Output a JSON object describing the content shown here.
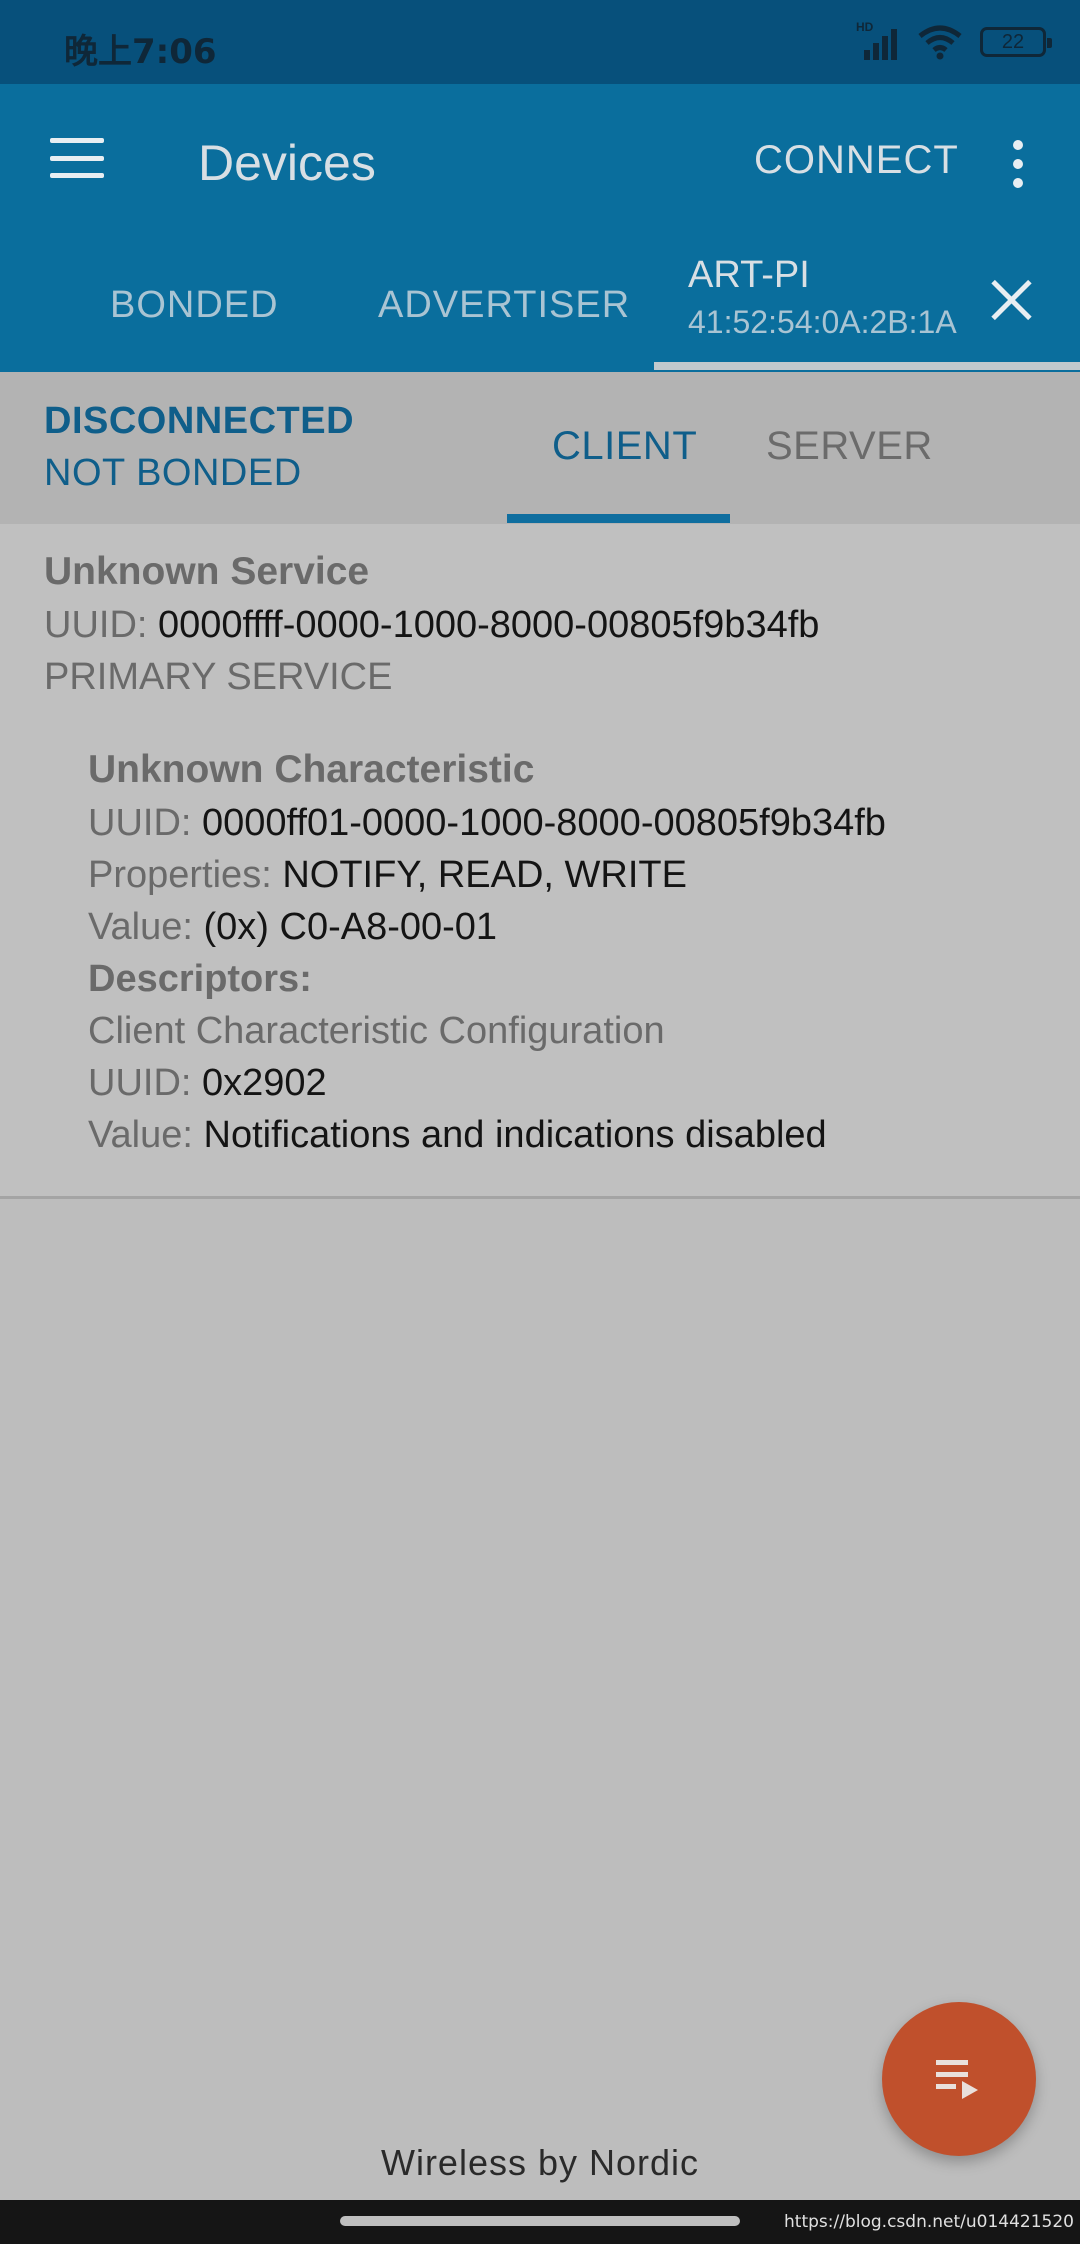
{
  "status_bar": {
    "time": "晚上7:06",
    "signal_label": "HD",
    "battery": "22"
  },
  "app_bar": {
    "title": "Devices",
    "connect_label": "CONNECT",
    "tabs": {
      "bonded": "BONDED",
      "advertiser": "ADVERTISER",
      "device_name": "ART-PI",
      "device_address": "41:52:54:0A:2B:1A"
    }
  },
  "connection": {
    "state": "DISCONNECTED",
    "bond": "NOT BONDED",
    "tabs": {
      "client": "CLIENT",
      "server": "SERVER"
    }
  },
  "service": {
    "name": "Unknown Service",
    "uuid_label": "UUID:",
    "uuid": "0000ffff-0000-1000-8000-00805f9b34fb",
    "type": "PRIMARY SERVICE",
    "characteristic": {
      "name": "Unknown Characteristic",
      "uuid_label": "UUID:",
      "uuid": "0000ff01-0000-1000-8000-00805f9b34fb",
      "properties_label": "Properties:",
      "properties": "NOTIFY, READ, WRITE",
      "value_label": "Value:",
      "value": "(0x) C0-A8-00-01",
      "descriptors_label": "Descriptors:",
      "descriptor": {
        "name": "Client Characteristic Configuration",
        "uuid_label": "UUID:",
        "uuid": "0x2902",
        "value_label": "Value:",
        "value": "Notifications and indications disabled"
      }
    }
  },
  "footer": "Wireless by Nordic",
  "watermark": "https://blog.csdn.net/u014421520",
  "colors": {
    "app_bar": "#0a6e9d",
    "accent": "#0f5e8a",
    "fab": "#c0502c"
  }
}
